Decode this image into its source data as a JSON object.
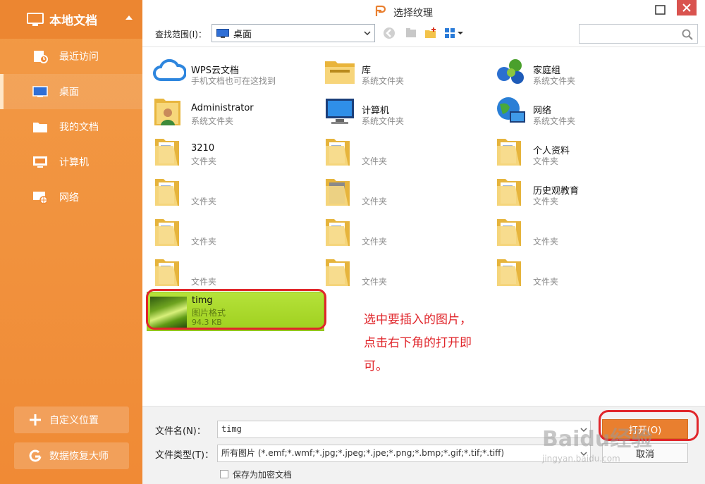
{
  "sidebar": {
    "title": "本地文档",
    "items": [
      {
        "label": "最近访问",
        "icon": "recent-icon"
      },
      {
        "label": "桌面",
        "icon": "desktop-icon",
        "active": true
      },
      {
        "label": "我的文档",
        "icon": "documents-icon"
      },
      {
        "label": "计算机",
        "icon": "computer-icon"
      },
      {
        "label": "网络",
        "icon": "network-icon"
      }
    ],
    "custom_location": "自定义位置",
    "data_recovery": "数据恢复大师"
  },
  "window": {
    "title": "选择纹理"
  },
  "toolbar": {
    "lookin_label": "查找范围(I)：",
    "lookin_value": "桌面"
  },
  "files": [
    {
      "name": "WPS云文档",
      "type": "手机文档也可在这找到",
      "icon": "cloud-icon"
    },
    {
      "name": "库",
      "type": "系统文件夹",
      "icon": "library-icon"
    },
    {
      "name": "家庭组",
      "type": "系统文件夹",
      "icon": "homegroup-icon"
    },
    {
      "name": "Administrator",
      "type": "系统文件夹",
      "icon": "user-folder-icon"
    },
    {
      "name": "计算机",
      "type": "系统文件夹",
      "icon": "computer-icon"
    },
    {
      "name": "网络",
      "type": "系统文件夹",
      "icon": "network-globe-icon"
    },
    {
      "name": "3210",
      "type": "文件夹",
      "icon": "folder-icon"
    },
    {
      "name": "",
      "type": "文件夹",
      "icon": "folder-icon"
    },
    {
      "name": "个人资料",
      "type": "文件夹",
      "icon": "folder-icon"
    },
    {
      "name": "",
      "type": "文件夹",
      "icon": "folder-icon"
    },
    {
      "name": "",
      "type": "文件夹",
      "icon": "folder-icon"
    },
    {
      "name": "历史观教育",
      "type": "文件夹",
      "icon": "folder-icon"
    },
    {
      "name": "",
      "type": "文件夹",
      "icon": "folder-icon"
    },
    {
      "name": "",
      "type": "文件夹",
      "icon": "folder-icon"
    },
    {
      "name": "",
      "type": "文件夹",
      "icon": "folder-icon"
    },
    {
      "name": "",
      "type": "文件夹",
      "icon": "folder-icon"
    },
    {
      "name": "",
      "type": "文件夹",
      "icon": "folder-icon"
    },
    {
      "name": "",
      "type": "文件夹",
      "icon": "folder-icon"
    },
    {
      "name": "timg",
      "type": "图片格式",
      "size": "94.3 KB",
      "icon": "image-thumbnail-icon",
      "selected": true
    }
  ],
  "annotation": {
    "lines": [
      "选中要插入的图片，",
      "点击右下角的打开即",
      "可。"
    ]
  },
  "bottom": {
    "filename_label": "文件名(N)：",
    "filename_value": "timg",
    "filetype_label": "文件类型(T)：",
    "filetype_value": "所有图片 (*.emf;*.wmf;*.jpg;*.jpeg;*.jpe;*.png;*.bmp;*.gif;*.tif;*.tiff)",
    "open_button": "打开(O)",
    "cancel_button": "取消",
    "encrypt_label": "保存为加密文档"
  },
  "watermark": {
    "main": "Baidu经验",
    "sub": "jingyan.baidu.com"
  },
  "colors": {
    "sidebar": "#f08a35",
    "accent": "#e97f2f",
    "selection": "#a8d82a",
    "annotation": "#e0262b"
  }
}
